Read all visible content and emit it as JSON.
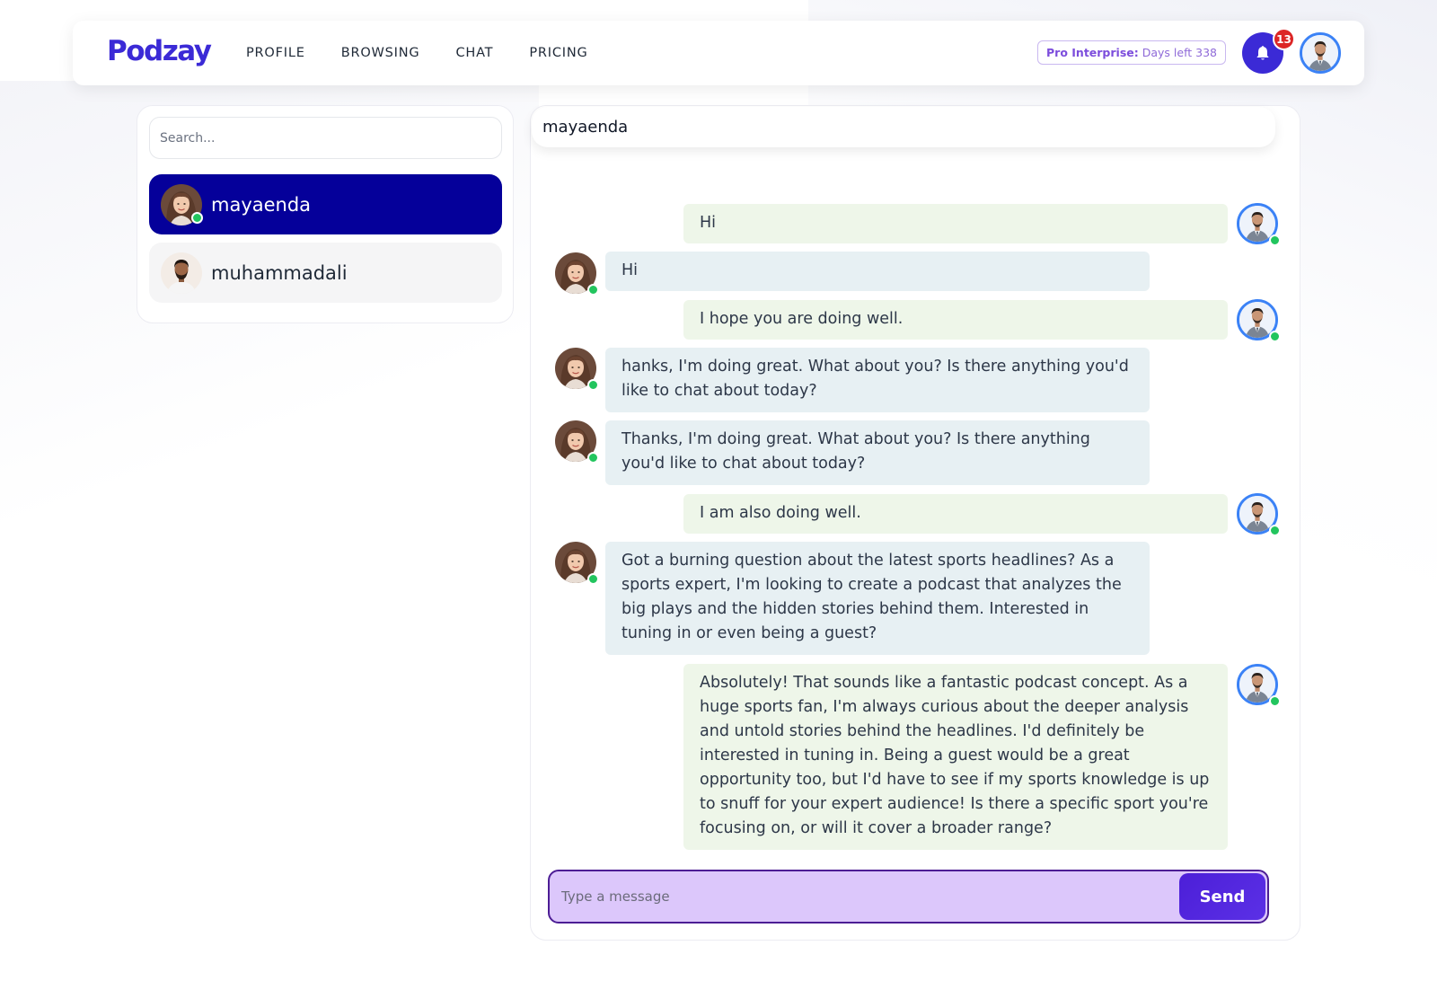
{
  "brand": {
    "logo_text": "Podzay",
    "accent": "#3b2ad6"
  },
  "nav": {
    "links": [
      {
        "label": "PROFILE"
      },
      {
        "label": "BROWSING"
      },
      {
        "label": "CHAT"
      },
      {
        "label": "PRICING"
      }
    ],
    "plan": {
      "label": "Pro Interprise:",
      "value": "Days left 338"
    },
    "notifications": {
      "count": "13"
    }
  },
  "sidebar": {
    "search_placeholder": "Search...",
    "contacts": [
      {
        "name": "mayaenda",
        "active": true,
        "online": true
      },
      {
        "name": "muhammadali",
        "active": false,
        "online": false
      }
    ]
  },
  "chat": {
    "header_title": "mayaenda",
    "messages": [
      {
        "from": "me",
        "text": "Hi"
      },
      {
        "from": "them",
        "text": "Hi"
      },
      {
        "from": "me",
        "text": "I hope you are doing well."
      },
      {
        "from": "them",
        "text": "hanks, I'm doing great. What about you? Is there anything you'd like to chat about today?"
      },
      {
        "from": "them",
        "text": "Thanks, I'm doing great. What about you? Is there anything you'd like to chat about today?"
      },
      {
        "from": "me",
        "text": "I am also doing well."
      },
      {
        "from": "them",
        "text": "Got a burning question about the latest sports headlines? As a sports expert, I'm looking to create a podcast that analyzes the big plays and the hidden stories behind them. Interested in tuning in or even being a guest?"
      },
      {
        "from": "me",
        "text": "Absolutely! That sounds like a fantastic podcast concept. As a huge sports fan, I'm always curious about the deeper analysis and untold stories behind the headlines. I'd definitely be interested in tuning in. Being a guest would be a great opportunity too, but I'd have to see if my sports knowledge is up to snuff for your expert audience! Is there a specific sport you're focusing on, or will it cover a broader range?"
      }
    ],
    "composer": {
      "placeholder": "Type a message",
      "send_label": "Send"
    }
  }
}
